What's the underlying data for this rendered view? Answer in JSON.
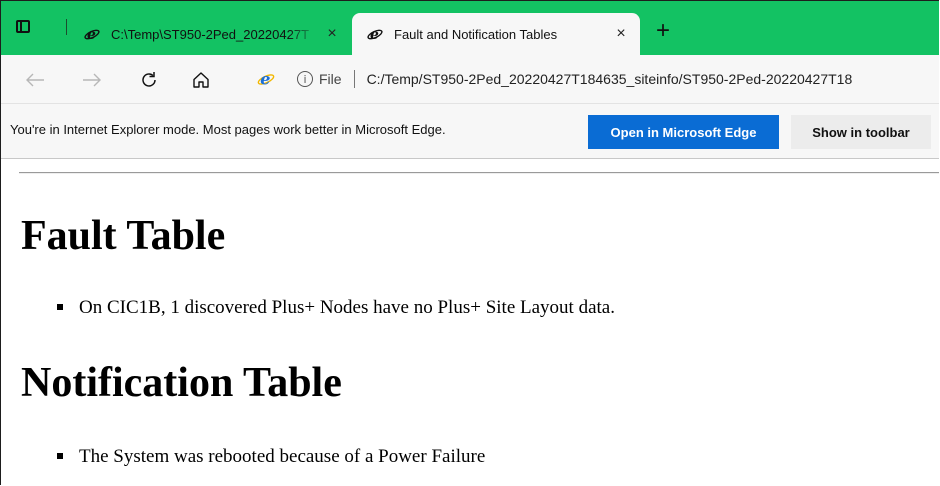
{
  "tabs": [
    {
      "title": "C:\\Temp\\ST950-2Ped_20220427T",
      "close": "×"
    },
    {
      "title": "Fault and Notification Tables",
      "close": "×"
    }
  ],
  "new_tab": "+",
  "toolbar": {
    "back_icon": "back-arrow-icon",
    "forward_icon": "forward-arrow-icon",
    "refresh_icon": "refresh-icon",
    "home_icon": "home-icon",
    "info": "i",
    "file_label": "File",
    "url": "C:/Temp/ST950-2Ped_20220427T184635_siteinfo/ST950-2Ped-20220427T18"
  },
  "ie_bar": {
    "message": "You're in Internet Explorer mode. Most pages work better in Microsoft Edge.",
    "open_button": "Open in Microsoft Edge",
    "show_button": "Show in toolbar"
  },
  "content": {
    "fault_heading": "Fault Table",
    "fault_items": [
      "On CIC1B, 1 discovered Plus+ Nodes have no Plus+ Site Layout data."
    ],
    "notification_heading": "Notification Table",
    "notification_items": [
      "The System was rebooted because of a Power Failure"
    ]
  },
  "colors": {
    "tabstrip": "#13c263",
    "primary_button": "#0a6cd4",
    "ie_logo": "#1b6fd6"
  }
}
